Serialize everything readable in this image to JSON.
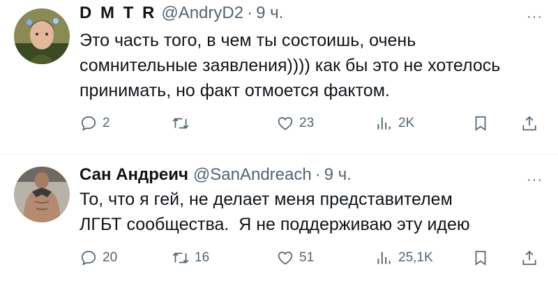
{
  "tweets": [
    {
      "display_name": "D M T R",
      "handle": "@AndryD2",
      "separator": "·",
      "time": "9 ч.",
      "more": "···",
      "text": "Это часть того, в чем ты состоишь, очень\nсомнительные заявления)))) как бы это не хотелось\nпринимать, но факт отмоется фактом.",
      "replies": "2",
      "retweets": "",
      "likes": "23",
      "views": "2K"
    },
    {
      "display_name": "Сан Андреич",
      "handle": "@SanAndreach",
      "separator": "·",
      "time": "9 ч.",
      "more": "···",
      "text": "То, что я гей, не делает меня представителем\nЛГБТ сообщества.  Я не поддерживаю эту идею",
      "replies": "20",
      "retweets": "16",
      "likes": "51",
      "views": "25,1K"
    }
  ],
  "icons": {
    "reply": "reply-icon",
    "retweet": "retweet-icon",
    "like": "heart-icon",
    "views": "views-icon",
    "bookmark": "bookmark-icon",
    "share": "share-icon",
    "more": "more-icon"
  },
  "colors": {
    "text": "#0f1419",
    "secondary": "#536471",
    "divider": "#eff3f4",
    "background": "#ffffff"
  }
}
